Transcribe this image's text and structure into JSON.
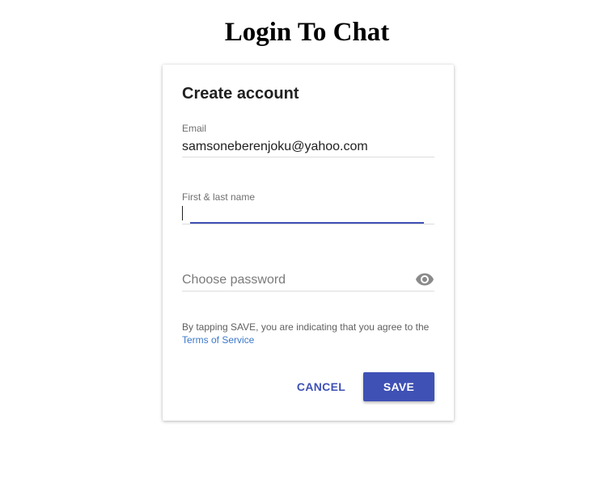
{
  "page": {
    "title": "Login To Chat"
  },
  "card": {
    "title": "Create account",
    "email": {
      "label": "Email",
      "value": "samsoneberenjoku@yahoo.com"
    },
    "name": {
      "label": "First & last name",
      "value": ""
    },
    "password": {
      "placeholder": "Choose password",
      "toggle_icon": "eye-icon"
    },
    "terms": {
      "text": "By tapping SAVE, you are indicating that you agree to the",
      "link": "Terms of Service"
    },
    "actions": {
      "cancel_label": "CANCEL",
      "save_label": "SAVE"
    }
  },
  "colors": {
    "accent": "#3f51b5",
    "link": "#3b78c9",
    "label": "#6f6f6f",
    "divider": "#dcdcdc"
  }
}
